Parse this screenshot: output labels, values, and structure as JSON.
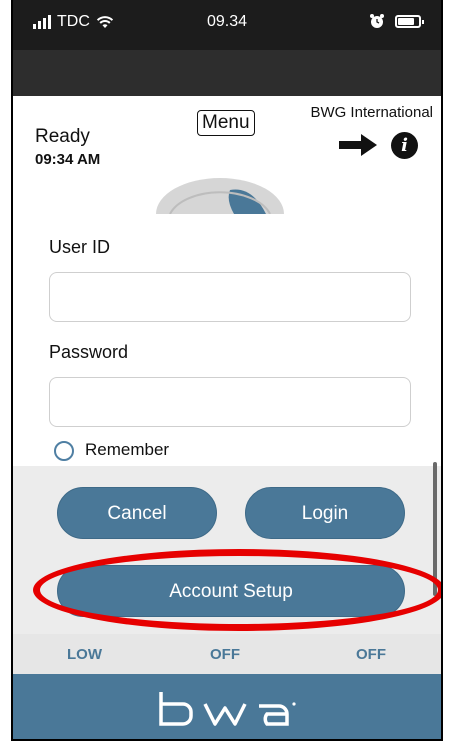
{
  "status_bar": {
    "carrier": "TDC",
    "time": "09.34"
  },
  "header": {
    "status": "Ready",
    "status_time": "09:34 AM",
    "menu_label": "Menu",
    "company": "BWG International",
    "next_icon": "right-arrow-icon",
    "info_icon": "info-icon",
    "info_glyph": "i"
  },
  "login": {
    "user_id_label": "User ID",
    "user_id_value": "",
    "password_label": "Password",
    "password_value": "",
    "remember_label": "Remember"
  },
  "buttons": {
    "cancel": "Cancel",
    "login": "Login",
    "account_setup": "Account Setup"
  },
  "levels": [
    "LOW",
    "OFF",
    "OFF"
  ],
  "footer": {
    "logo_text": "bwa"
  },
  "colors": {
    "accent": "#4a7898",
    "highlight": "#e60000",
    "status_bar": "#1c1c1c"
  }
}
